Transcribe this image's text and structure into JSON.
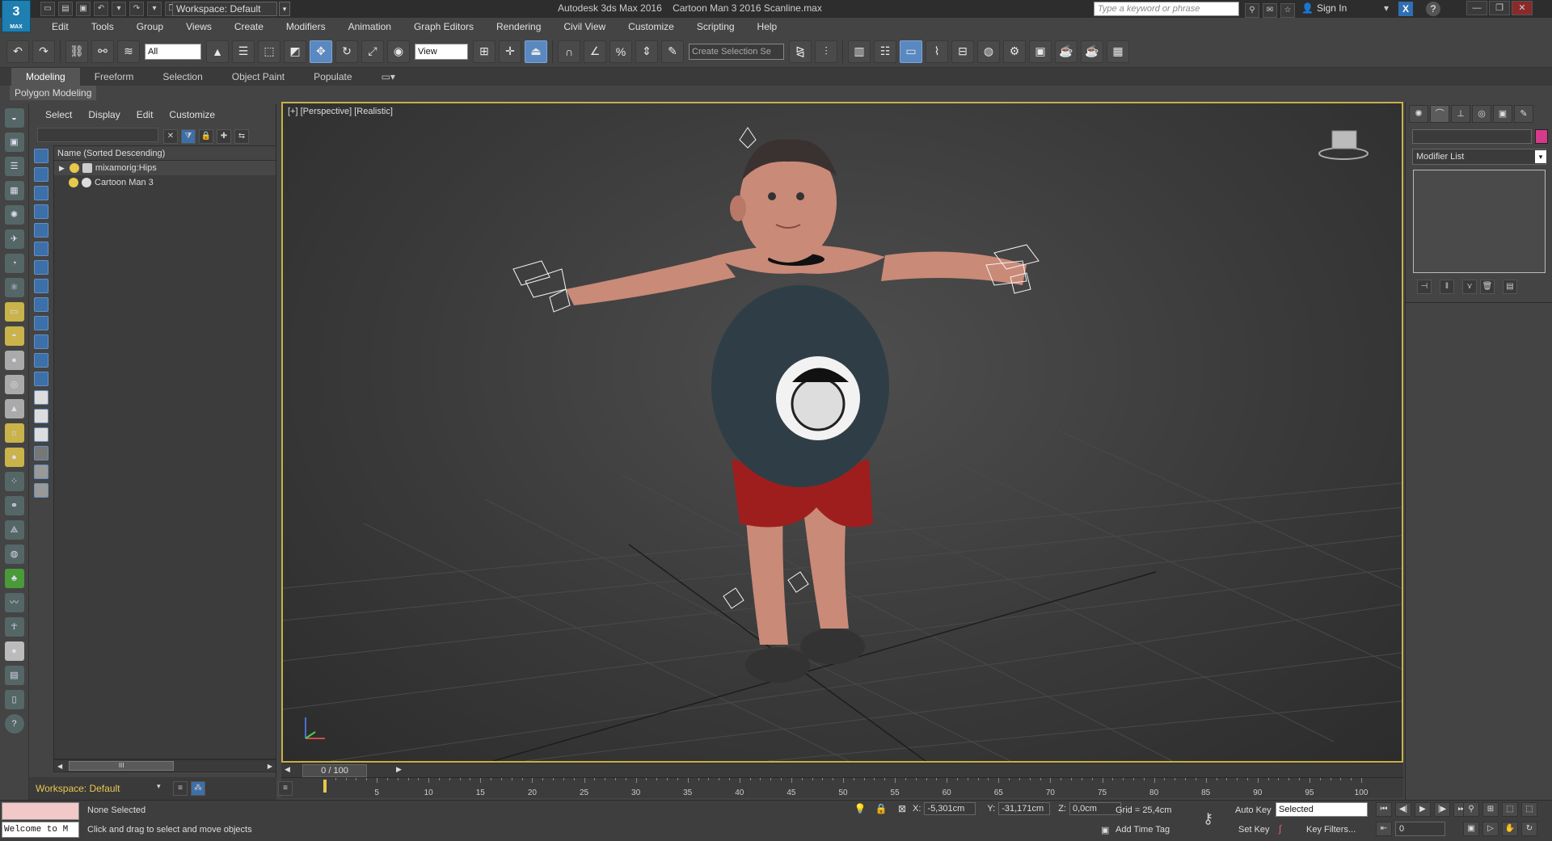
{
  "app": {
    "logo_text": "3",
    "logo_sub": "MAX",
    "title": "Autodesk 3ds Max 2016    Cartoon Man 3 2016 Scanline.max",
    "workspace": "Workspace: Default",
    "search_placeholder": "Type a keyword or phrase",
    "sign_in": "Sign In"
  },
  "menu": [
    "Edit",
    "Tools",
    "Group",
    "Views",
    "Create",
    "Modifiers",
    "Animation",
    "Graph Editors",
    "Rendering",
    "Civil View",
    "Customize",
    "Scripting",
    "Help"
  ],
  "toolbar": {
    "selection_filter": "All",
    "ref_coord": "View",
    "named_selection_placeholder": "Create Selection Se"
  },
  "ribbon": {
    "tabs": [
      "Modeling",
      "Freeform",
      "Selection",
      "Object Paint",
      "Populate"
    ],
    "active": "Modeling",
    "panel_label": "Polygon Modeling"
  },
  "explorer": {
    "menu": [
      "Select",
      "Display",
      "Edit",
      "Customize"
    ],
    "header": "Name (Sorted Descending)",
    "items": [
      {
        "label": "mixamorig:Hips"
      },
      {
        "label": "Cartoon Man 3"
      }
    ],
    "scroll_label": "III",
    "workspace": "Workspace: Default"
  },
  "viewport": {
    "label": "[+] [Perspective] [Realistic]"
  },
  "command_panel": {
    "modifier_list": "Modifier List",
    "object_color": "#d63a8a"
  },
  "timeline": {
    "thumb": "0 / 100",
    "ticks": [
      "5",
      "10",
      "15",
      "20",
      "25",
      "30",
      "35",
      "40",
      "45",
      "50",
      "55",
      "60",
      "65",
      "70",
      "75",
      "80",
      "85",
      "90",
      "95",
      "100"
    ]
  },
  "status": {
    "maxscript": "Welcome to M",
    "selection": "None Selected",
    "prompt": "Click and drag to select and move objects",
    "x": "-5,301cm",
    "y": "-31,171cm",
    "z": "0,0cm",
    "grid": "Grid = 25,4cm",
    "add_time_tag": "Add Time Tag",
    "auto_key": "Auto Key",
    "set_key": "Set Key",
    "selected": "Selected",
    "key_filters": "Key Filters...",
    "frame": "0"
  }
}
